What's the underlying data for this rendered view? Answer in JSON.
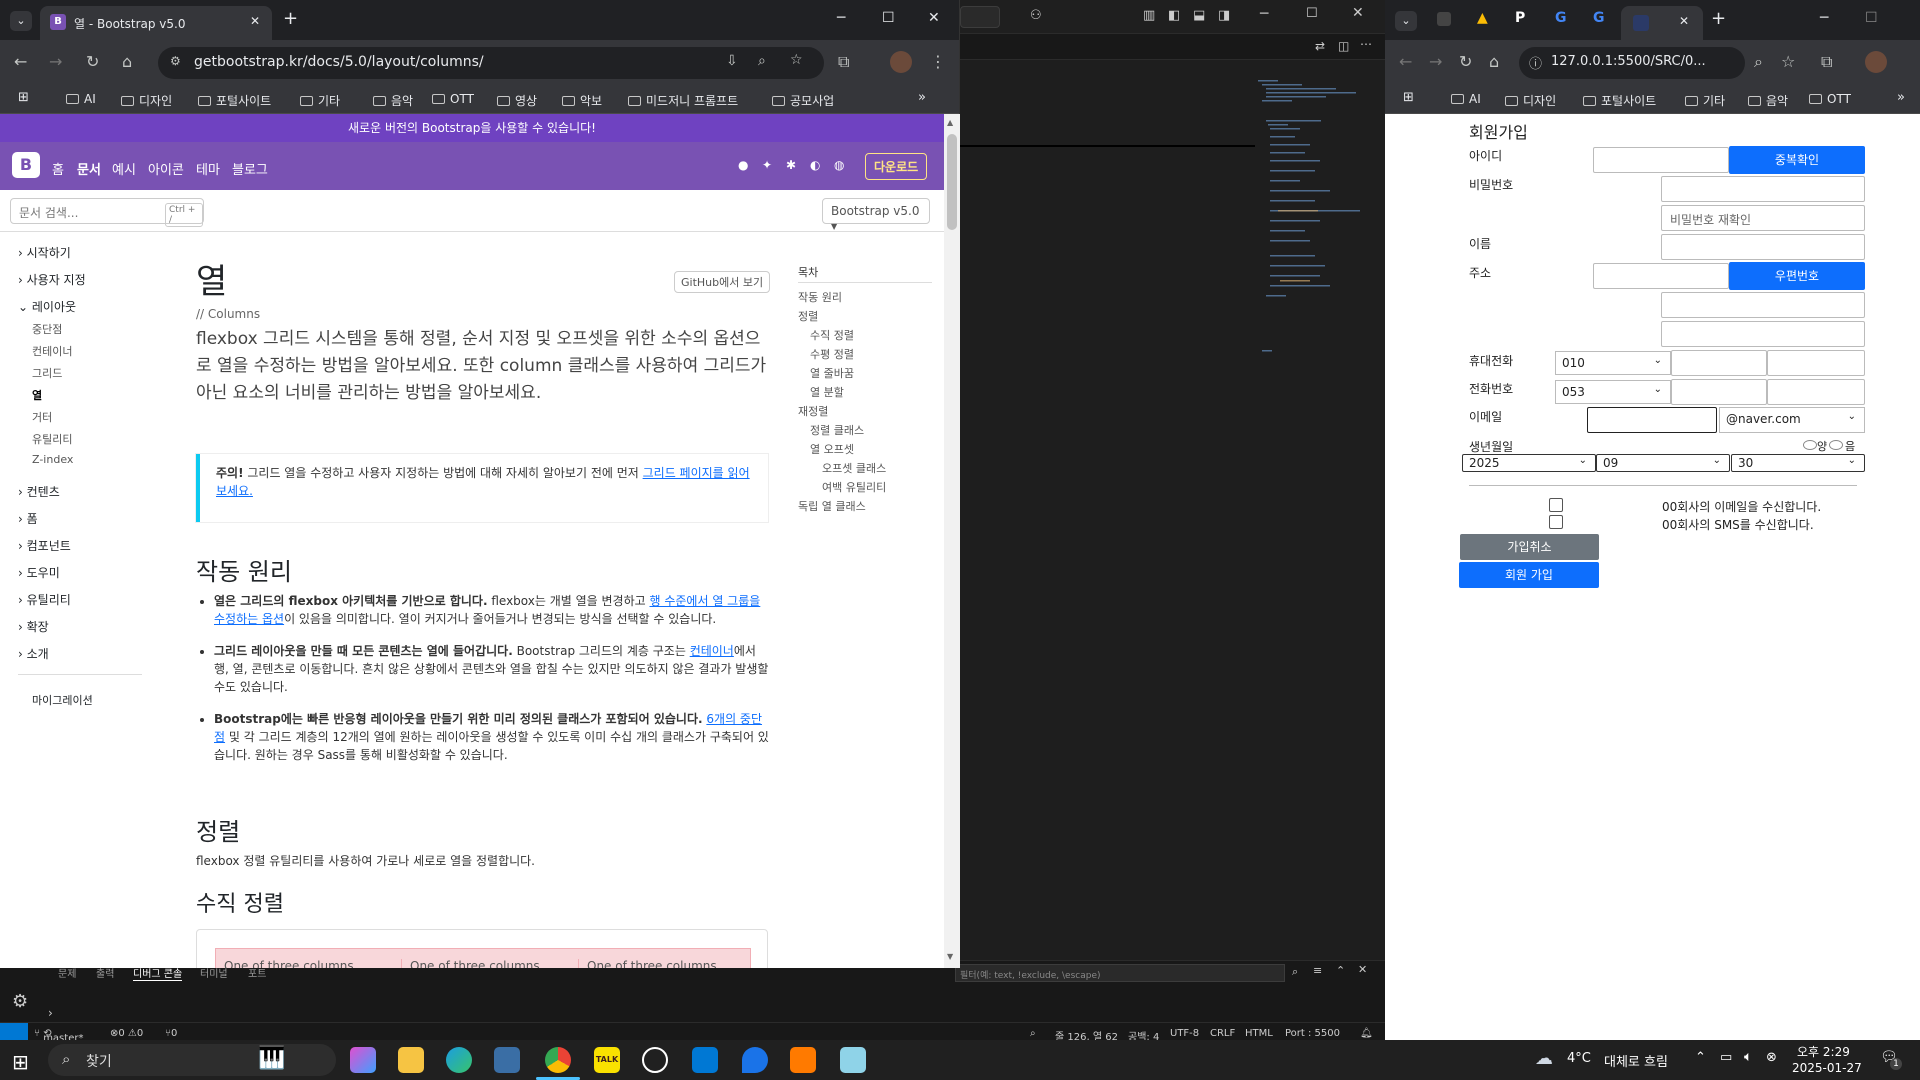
{
  "vscode": {
    "panel_tabs": [
      "문제",
      "출력",
      "디버그 콘솔",
      "터미널",
      "포트"
    ],
    "filter_placeholder": "필터(예: text, !exclude, \\escape)",
    "status": {
      "branch": "master*",
      "errors": "⊗0 ⚠0",
      "ports": "⑂0",
      "cursor": "줄 126, 열 62",
      "spaces": "공백: 4",
      "encoding": "UTF-8",
      "eol": "CRLF",
      "lang": "HTML",
      "port": "Port : 5500"
    }
  },
  "chrome_left": {
    "tab_title": "열 - Bootstrap v5.0",
    "url": "getbootstrap.kr/docs/5.0/layout/columns/",
    "bookmarks": [
      "AI",
      "디자인",
      "포털사이트",
      "기타",
      "음악",
      "OTT",
      "영상",
      "악보",
      "미드저니 프롬프트",
      "공모사업"
    ],
    "page": {
      "banner": "새로운 버전의 Bootstrap을 사용할 수 있습니다!",
      "nav": [
        "홈",
        "문서",
        "예시",
        "아이콘",
        "테마",
        "블로그"
      ],
      "download": "다운로드",
      "search_placeholder": "문서 검색...",
      "search_kbd": "Ctrl + /",
      "version": "Bootstrap v5.0",
      "sidebar": [
        {
          "label": "시작하기",
          "open": false
        },
        {
          "label": "사용자 지정",
          "open": false
        },
        {
          "label": "레이아웃",
          "open": true,
          "children": [
            "중단점",
            "컨테이너",
            "그리드",
            "열",
            "거터",
            "유틸리티",
            "Z-index"
          ]
        },
        {
          "label": "컨텐츠",
          "open": false
        },
        {
          "label": "폼",
          "open": false
        },
        {
          "label": "컴포넌트",
          "open": false
        },
        {
          "label": "도우미",
          "open": false
        },
        {
          "label": "유틸리티",
          "open": false
        },
        {
          "label": "확장",
          "open": false
        },
        {
          "label": "소개",
          "open": false
        }
      ],
      "migration": "마이그레이션",
      "title": "열",
      "github_btn": "GitHub에서 보기",
      "subtitle": "// Columns",
      "lead": "flexbox 그리드 시스템을 통해 정렬, 순서 지정 및 오프셋을 위한 소수의 옵션으로 열을 수정하는 방법을 알아보세요. 또한 column 클래스를 사용하여 그리드가 아닌 요소의 너비를 관리하는 방법을 알아보세요.",
      "callout_strong": "주의!",
      "callout_text": " 그리드 열을 수정하고 사용자 지정하는 방법에 대해 자세히 알아보기 전에 먼저 ",
      "callout_link": "그리드 페이지를 읽어보세요.",
      "h_how": "작동 원리",
      "bullets": [
        {
          "strong": "열은 그리드의 flexbox 아키텍처를 기반으로 합니다.",
          "pre": " flexbox는 개별 열을 변경하고 ",
          "link": "행 수준에서 열 그룹을 수정하는 옵션",
          "post": "이 있음을 의미합니다. 열이 커지거나 줄어들거나 변경되는 방식을 선택할 수 있습니다."
        },
        {
          "strong": "그리드 레이아웃을 만들 때 모든 콘텐츠는 열에 들어갑니다.",
          "pre": " Bootstrap 그리드의 계층 구조는 ",
          "link": "컨테이너",
          "post": "에서 행, 열, 콘텐츠로 이동합니다. 흔치 않은 상황에서 콘텐츠와 열을 합칠 수는 있지만 의도하지 않은 결과가 발생할 수도 있습니다."
        },
        {
          "strong": "Bootstrap에는 빠른 반응형 레이아웃을 만들기 위한 미리 정의된 클래스가 포함되어 있습니다.",
          "pre": " ",
          "link": "6개의 중단점",
          "post": " 및 각 그리드 계층의 12개의 열에 원하는 레이아웃을 생성할 수 있도록 이미 수십 개의 클래스가 구축되어 있습니다. 원하는 경우 Sass를 통해 비활성화할 수 있습니다."
        }
      ],
      "h_align": "정렬",
      "align_text": "flexbox 정렬 유틸리티를 사용하여 가로나 세로로 열을 정렬합니다.",
      "h_valign": "수직 정렬",
      "demo_cell": "One of three columns",
      "toc_title": "목차",
      "toc": [
        {
          "label": "작동 원리",
          "lvl": 0
        },
        {
          "label": "정렬",
          "lvl": 0
        },
        {
          "label": "수직 정렬",
          "lvl": 1
        },
        {
          "label": "수평 정렬",
          "lvl": 1
        },
        {
          "label": "열 줄바꿈",
          "lvl": 1
        },
        {
          "label": "열 분할",
          "lvl": 1
        },
        {
          "label": "재정렬",
          "lvl": 0
        },
        {
          "label": "정렬 클래스",
          "lvl": 1
        },
        {
          "label": "열 오프셋",
          "lvl": 1
        },
        {
          "label": "오프셋 클래스",
          "lvl": 2
        },
        {
          "label": "여백 유틸리티",
          "lvl": 2
        },
        {
          "label": "독립 열 클래스",
          "lvl": 0
        }
      ]
    }
  },
  "chrome_right": {
    "url": "127.0.0.1:5500/SRC/0...",
    "bookmarks": [
      "AI",
      "디자인",
      "포털사이트",
      "기타",
      "음악",
      "OTT"
    ],
    "form": {
      "title": "회원가입",
      "id_label": "아이디",
      "dup_check": "중복확인",
      "pw_label": "비밀번호",
      "pw_confirm_placeholder": "비밀번호 재확인",
      "name_label": "이름",
      "addr_label": "주소",
      "zip_btn": "우편번호",
      "mobile_label": "휴대전화",
      "mobile_prefix": "010",
      "phone_label": "전화번호",
      "phone_prefix": "053",
      "email_label": "이메일",
      "email_domain": "@naver.com",
      "birth_label": "생년월일",
      "birth_year": "2025",
      "birth_month": "09",
      "birth_day": "30",
      "cal_solar": "양",
      "cal_lunar": "음",
      "agree_email": "00회사의 이메일을 수신합니다.",
      "agree_sms": "00회사의 SMS를 수신합니다.",
      "cancel_btn": "가입취소",
      "submit_btn": "회원 가입"
    }
  },
  "taskbar": {
    "search": "찾기",
    "weather_temp": "4°C",
    "weather_desc": "대체로 흐림",
    "time": "오후 2:29",
    "date": "2025-01-27",
    "notif_count": "1"
  },
  "colors": {
    "bootstrap_purple": "#7952b3",
    "primary": "#0d6efd",
    "cancel_gray": "#6c757d"
  }
}
